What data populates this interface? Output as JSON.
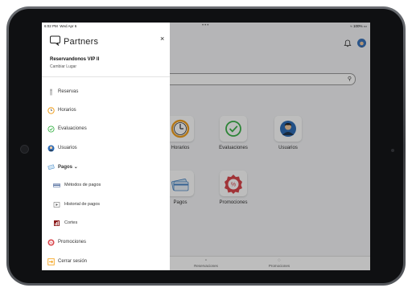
{
  "status": {
    "time": "6:02 PM",
    "date": "Wed Apr 6",
    "battery": "100%"
  },
  "drawer": {
    "brand": "Partners",
    "venue": "Reservandonos VIP II",
    "change_place": "Cambiar Lugar",
    "items": [
      {
        "label": "Reservas",
        "icon": "reservations-icon"
      },
      {
        "label": "Horarios",
        "icon": "clock-icon"
      },
      {
        "label": "Evaluaciones",
        "icon": "check-circle-icon"
      },
      {
        "label": "Usuarios",
        "icon": "user-icon"
      },
      {
        "label": "Pagos",
        "icon": "payment-icon",
        "caret": "⌄"
      },
      {
        "label": "Métodos de pagos",
        "icon": "card-icon"
      },
      {
        "label": "Historial de pagos",
        "icon": "history-icon"
      },
      {
        "label": "Cortes",
        "icon": "chart-icon"
      },
      {
        "label": "Promociones",
        "icon": "promo-icon"
      },
      {
        "label": "Cerrar sesión",
        "icon": "logout-icon"
      }
    ]
  },
  "tiles": [
    {
      "label": "Horarios",
      "icon": "clock-icon"
    },
    {
      "label": "Evaluaciones",
      "icon": "check-circle-icon"
    },
    {
      "label": "Usuarios",
      "icon": "user-icon"
    },
    {
      "label": "Pagos",
      "icon": "payment-icon"
    },
    {
      "label": "Promociones",
      "icon": "promo-icon"
    }
  ],
  "bottom_nav": [
    {
      "label": "Reservaciones",
      "icon": "calendar-icon"
    },
    {
      "label": "Promociones",
      "icon": "promo-icon"
    }
  ],
  "colors": {
    "accent_orange": "#f5a623",
    "green": "#3cb34a",
    "promo_red": "#d9454b",
    "user_blue": "#2f6db5"
  }
}
